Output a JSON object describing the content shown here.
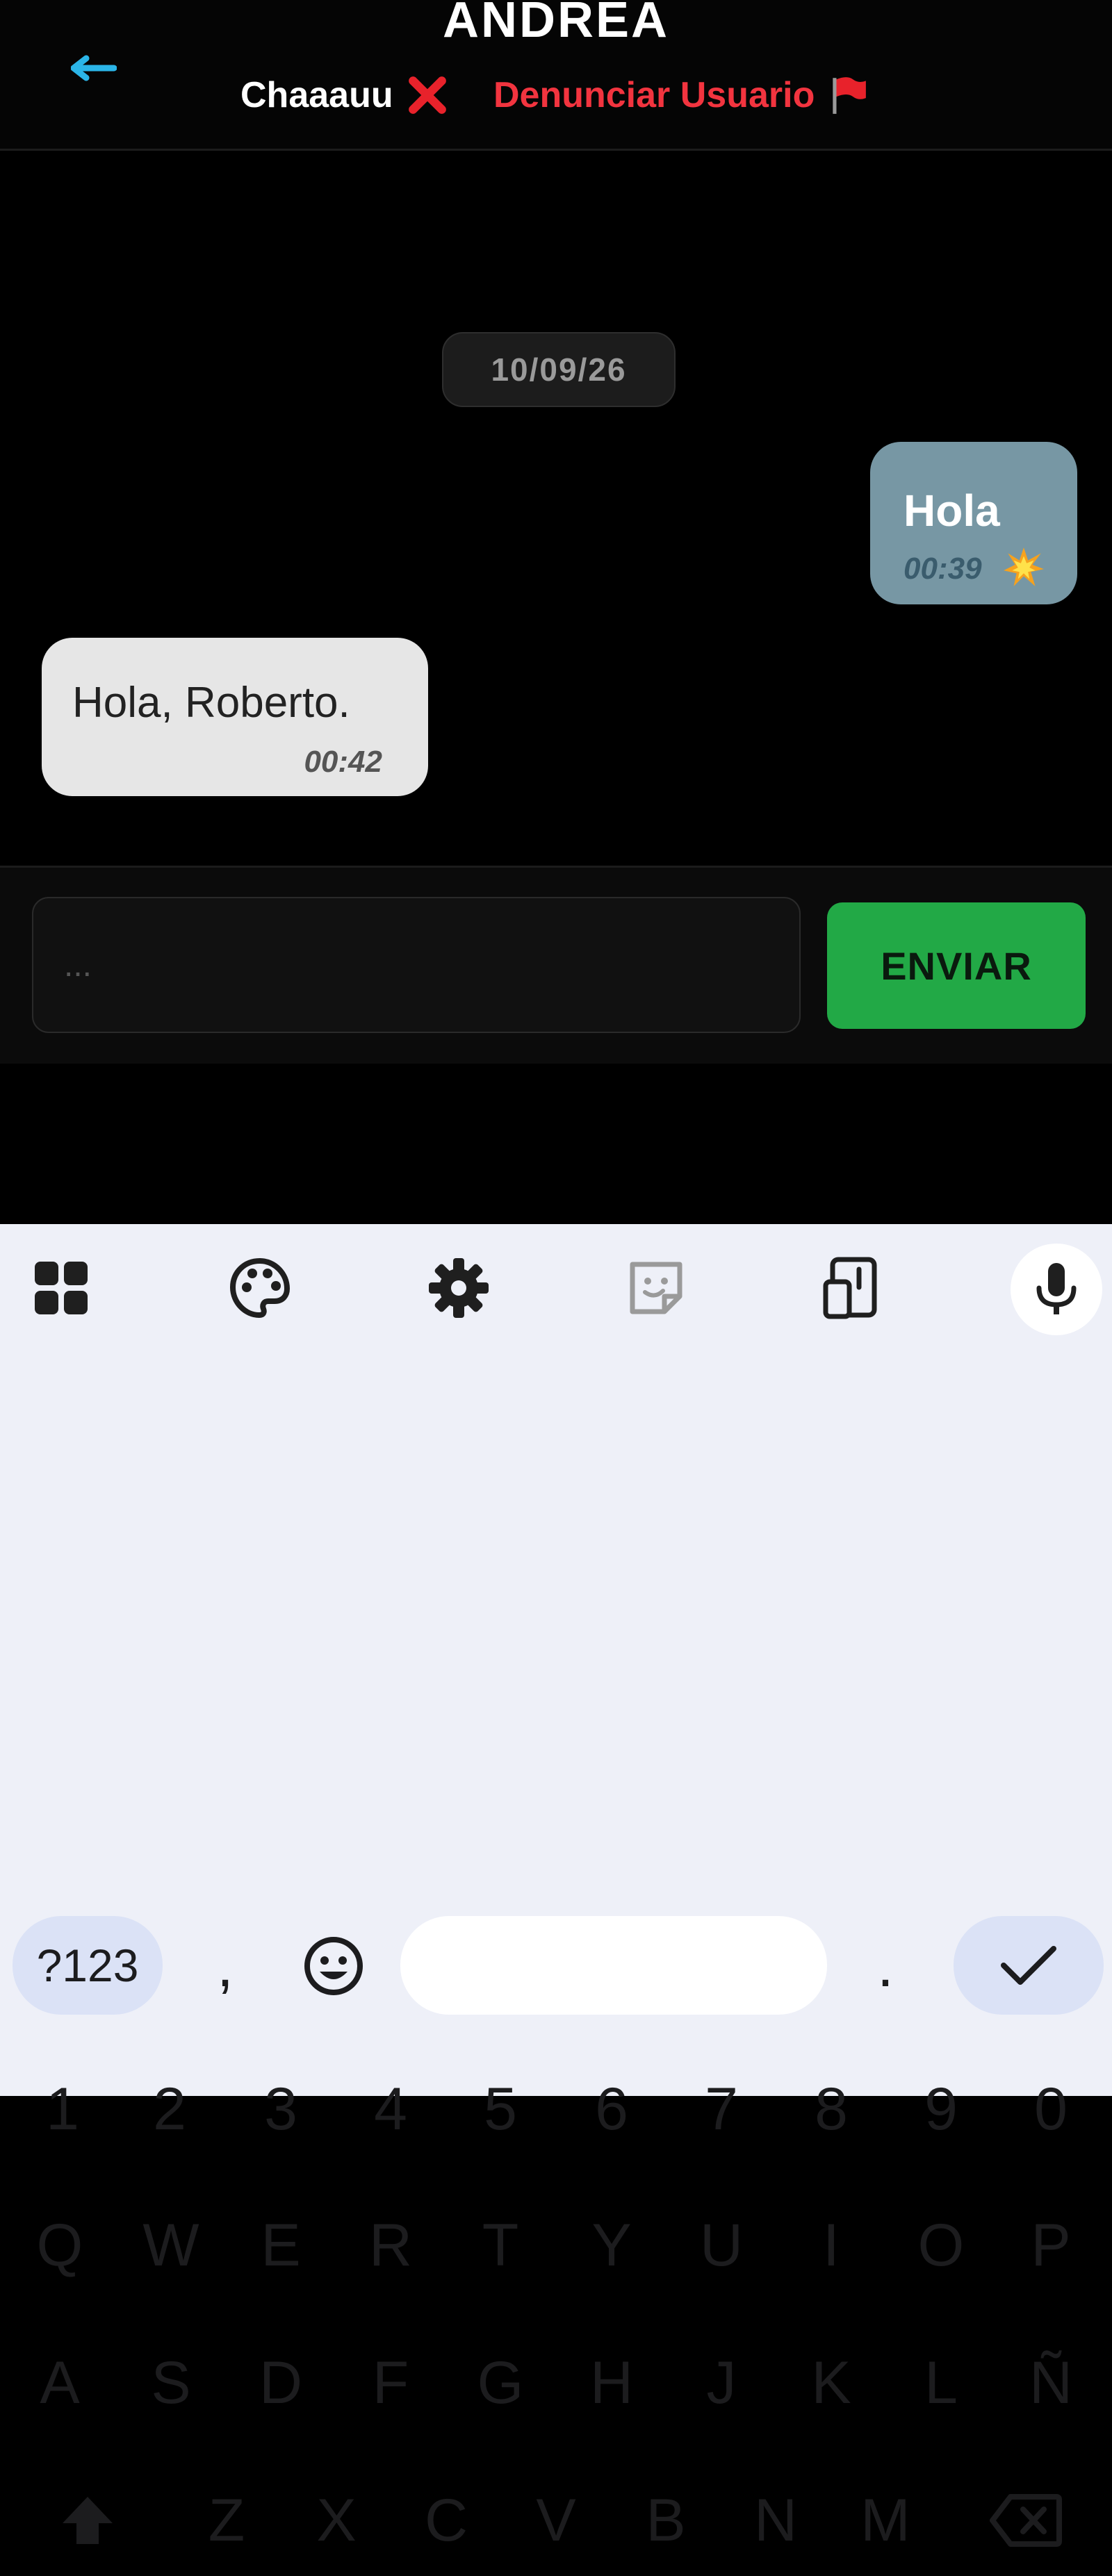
{
  "header": {
    "contact_name": "ANDREA",
    "chau_label": "Chaaauu",
    "report_label": "Denunciar Usuario"
  },
  "chat": {
    "date": "10/09/26",
    "messages": [
      {
        "direction": "outgoing",
        "text": "Hola",
        "time": "00:39"
      },
      {
        "direction": "incoming",
        "text": "Hola, Roberto.",
        "time": "00:42"
      }
    ]
  },
  "composer": {
    "placeholder": "...",
    "value": "",
    "send_label": "ENVIAR"
  },
  "keyboard": {
    "toolbar": [
      "apps-grid-icon",
      "palette-icon",
      "gear-icon",
      "sticker-icon",
      "clipboard-icon",
      "microphone-icon"
    ],
    "rows": [
      [
        "1",
        "2",
        "3",
        "4",
        "5",
        "6",
        "7",
        "8",
        "9",
        "0"
      ],
      [
        "Q",
        "W",
        "E",
        "R",
        "T",
        "Y",
        "U",
        "I",
        "O",
        "P"
      ],
      [
        "A",
        "S",
        "D",
        "F",
        "G",
        "H",
        "J",
        "K",
        "L",
        "Ñ"
      ],
      [
        "Z",
        "X",
        "C",
        "V",
        "B",
        "N",
        "M"
      ]
    ],
    "symbols_label": "?123",
    "comma": ",",
    "period": "."
  },
  "colors": {
    "accent_back": "#2bb5e8",
    "report_red": "#f2343f",
    "send_green": "#22a946",
    "outgoing_bubble": "#7797a4",
    "incoming_bubble": "#e6e6e6"
  }
}
